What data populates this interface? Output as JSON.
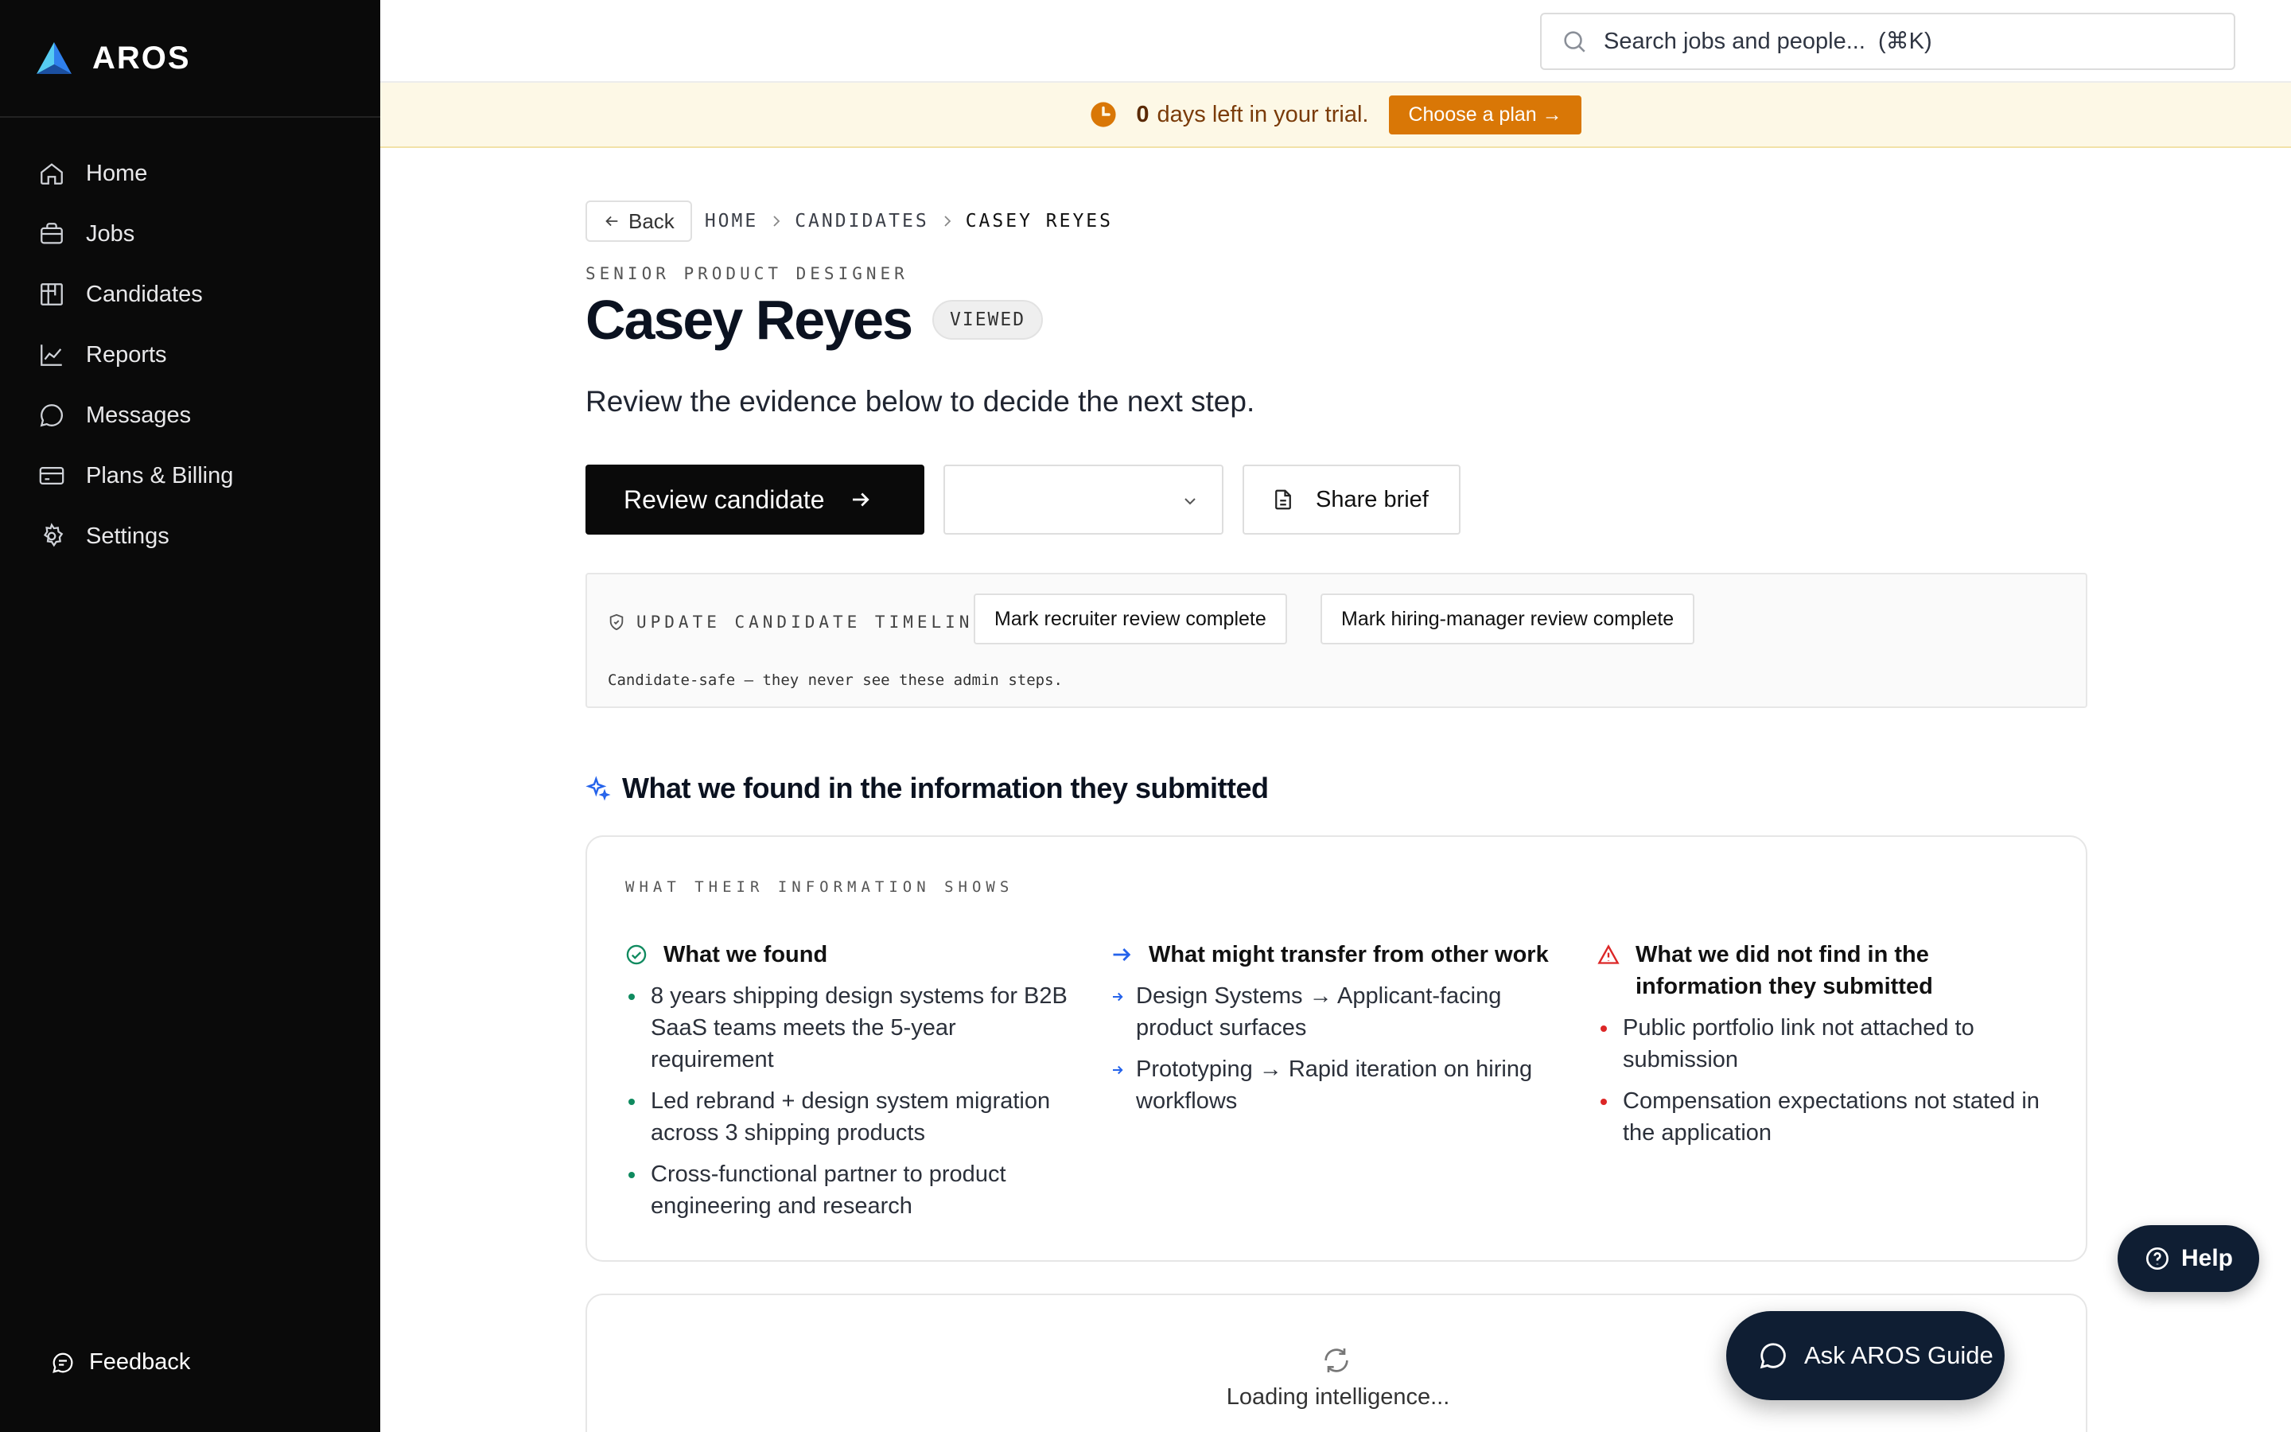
{
  "brand": {
    "name": "AROS"
  },
  "sidebar": {
    "items": [
      {
        "label": "Home",
        "icon": "home-icon"
      },
      {
        "label": "Jobs",
        "icon": "briefcase-icon"
      },
      {
        "label": "Candidates",
        "icon": "kanban-icon"
      },
      {
        "label": "Reports",
        "icon": "chart-icon"
      },
      {
        "label": "Messages",
        "icon": "message-icon"
      },
      {
        "label": "Plans & Billing",
        "icon": "credit-card-icon"
      },
      {
        "label": "Settings",
        "icon": "gear-icon"
      }
    ],
    "feedback_label": "Feedback"
  },
  "search": {
    "placeholder": "Search jobs and people...  (⌘K)"
  },
  "trial": {
    "days": "0",
    "text": "days left in your trial.",
    "button": "Choose a plan →"
  },
  "breadcrumb": {
    "back": "Back",
    "home": "HOME",
    "candidates": "CANDIDATES",
    "current": "CASEY REYES"
  },
  "candidate": {
    "role": "SENIOR PRODUCT DESIGNER",
    "name": "Casey Reyes",
    "status": "VIEWED",
    "subtitle": "Review the evidence below to decide the next step."
  },
  "actions": {
    "review": "Review candidate",
    "select_value": "",
    "share": "Share brief"
  },
  "timeline": {
    "label": "UPDATE CANDIDATE TIMELINE",
    "recruiter_button": "Mark recruiter review complete",
    "manager_button": "Mark hiring-manager review complete",
    "note": "Candidate-safe — they never see these admin steps."
  },
  "findings": {
    "heading": "What we found in the information they submitted",
    "card_label": "WHAT THEIR INFORMATION SHOWS",
    "found_title": "What we found",
    "found": [
      "8 years shipping design systems for B2B SaaS teams meets the 5-year requirement",
      "Led rebrand + design system migration across 3 shipping products",
      "Cross-functional partner to product engineering and research"
    ],
    "transfer_title": "What might transfer from other work",
    "transfer": [
      "Design Systems → Applicant-facing product surfaces",
      "Prototyping → Rapid iteration on hiring workflows"
    ],
    "missing_title": "What we did not find in the information they submitted",
    "missing": [
      "Public portfolio link not attached to submission",
      "Compensation expectations not stated in the application"
    ]
  },
  "loading": {
    "text": "Loading intelligence..."
  },
  "help": {
    "label": "Help"
  },
  "guide": {
    "label": "Ask AROS Guide"
  },
  "colors": {
    "accent": "#0a0a0a",
    "trial_bg": "#fdf8e6",
    "trial_button": "#d97706",
    "found": "#0f8a5f",
    "transfer": "#2563eb",
    "missing": "#dc2626",
    "navy": "#0f1e33"
  }
}
